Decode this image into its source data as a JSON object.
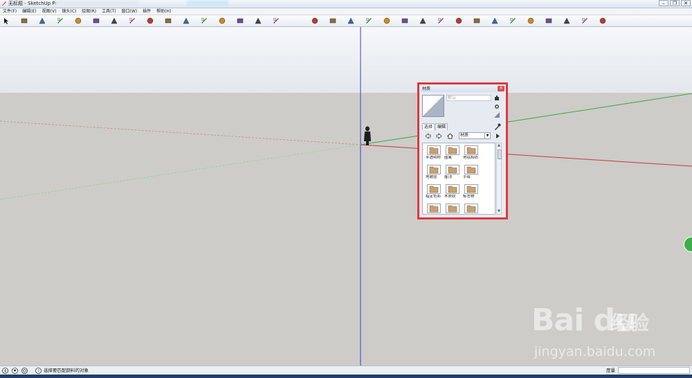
{
  "window": {
    "title": "无标题 - SketchUp Pro",
    "controls": [
      "minimize-icon",
      "restore-icon",
      "close-icon"
    ]
  },
  "menubar": {
    "items": [
      "文件(F)",
      "编辑(E)",
      "视图(V)",
      "镜头(C)",
      "绘图(R)",
      "工具(T)",
      "窗口(W)",
      "插件",
      "帮助(H)"
    ]
  },
  "toolbar": {
    "icons": [
      "select-icon",
      "pencil-icon",
      "rectangle-icon",
      "circle-icon",
      "arc-icon",
      "eraser-icon",
      "tape-icon",
      "paint-bucket-icon",
      "push-pull-icon",
      "move-icon",
      "rotate-icon",
      "offset-icon",
      "orbit-icon",
      "pan-icon",
      "zoom-icon",
      "zoom-extents-icon",
      "previous-view-icon",
      "camera-icon",
      "walk-icon",
      "look-around-icon",
      "section-icon",
      "component-icon",
      "group-icon",
      "text-icon",
      "dimension-icon",
      "protractor-icon",
      "axes-icon",
      "3d-text-icon",
      "sun-icon",
      "fog-icon",
      "sandbox-icon",
      "warehouse-icon",
      "help-icon"
    ]
  },
  "materials_panel": {
    "title": "材质",
    "name_value": "默认",
    "tabs": [
      {
        "label": "选择",
        "active": true
      },
      {
        "label": "编辑",
        "active": false
      }
    ],
    "library": "材质",
    "items": [
      "半透明材",
      "围篱",
      "地毯和纺",
      "地被层",
      "屋顶",
      "手绘",
      "指定色彩",
      "木质纹",
      "标志物",
      "",
      "",
      ""
    ],
    "accent_color": "#e0373f"
  },
  "statusbar": {
    "hint": "选择要匹配颜料的对象",
    "measure_label": "度量",
    "measure_value": ""
  },
  "watermark": {
    "brand": "Bai du",
    "cn": "经验",
    "url": "jingyan.baidu.com"
  },
  "colors": {
    "sky": "#eef1f4",
    "ground": "#cdccc8",
    "axis_blue": "#3a3ad0",
    "axis_green": "#3aa53a",
    "axis_red": "#c23a3a"
  }
}
